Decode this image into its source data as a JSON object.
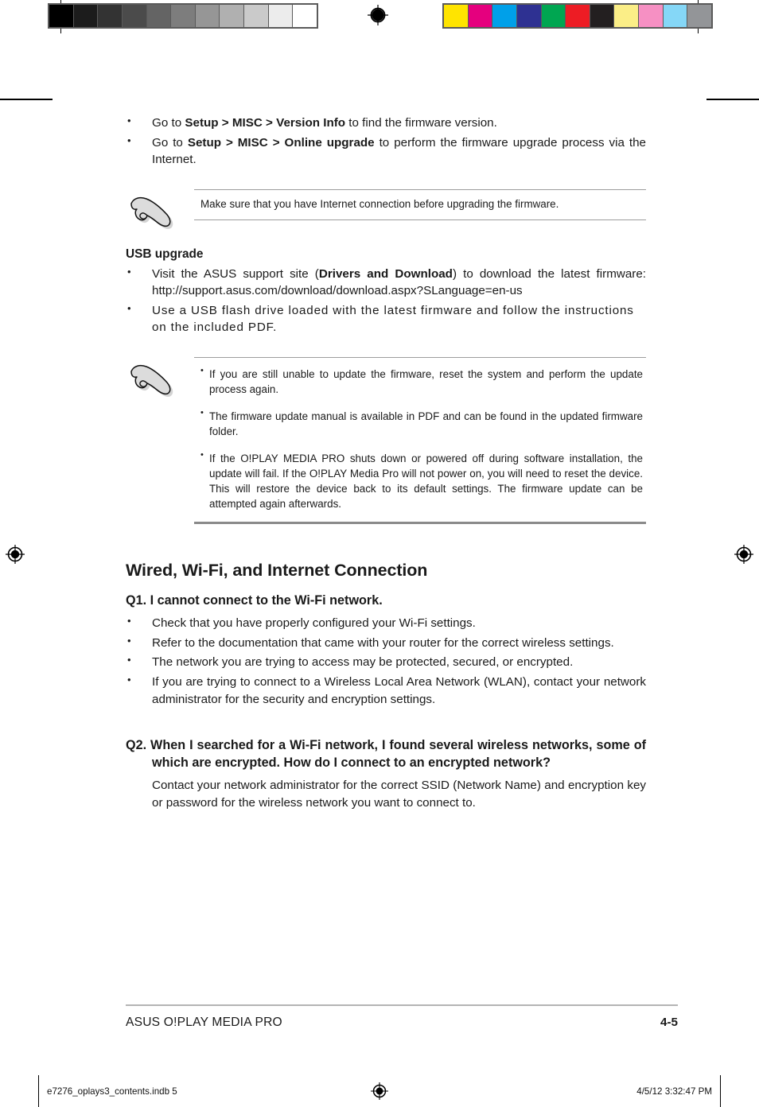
{
  "page": {
    "doc_title": "ASUS O!PLAY MEDIA PRO",
    "page_number": "4-5"
  },
  "firmware_bullets": [
    {
      "pre": "Go to ",
      "bold": "Setup > MISC > Version Info",
      "post": " to find the firmware version."
    },
    {
      "pre": "Go to ",
      "bold": "Setup > MISC > Online upgrade",
      "post": " to perform the firmware upgrade process via the Internet."
    }
  ],
  "note1": {
    "icon": "pointing-hand-icon",
    "text": "Make sure that you have Internet connection before upgrading the firmware."
  },
  "usb_upgrade": {
    "heading": "USB upgrade",
    "bullets": [
      {
        "pre": "Visit the ASUS support site (",
        "bold": "Drivers and Download",
        "post": ") to download the latest firmware: http://support.asus.com/download/download.aspx?SLanguage=en-us"
      },
      {
        "pre": "",
        "bold": "",
        "post": "Use a USB flash drive loaded with the latest firmware and follow the instructions on the included PDF."
      }
    ]
  },
  "note2": {
    "icon": "pointing-hand-icon",
    "bullets": [
      "If you are still unable to update the firmware, reset the system and perform the update process again.",
      "The firmware update manual is available in PDF and can be found in the updated firmware folder.",
      "If the O!PLAY MEDIA PRO shuts down or powered off during software installation, the update will fail. If the O!PLAY Media Pro will not power on, you will need to reset the device. This will restore the device back to its default settings.  The firmware update can be attempted again afterwards."
    ]
  },
  "connection_section": {
    "heading": "Wired, Wi-Fi, and Internet Connection",
    "q1": {
      "heading": "Q1. I cannot connect to the Wi-Fi network.",
      "bullets": [
        "Check that you have properly configured your Wi-Fi settings.",
        "Refer to the documentation that came with your router for the correct wireless settings.",
        "The network you are trying to access may be protected, secured, or encrypted.",
        "If you are trying to connect to a Wireless Local Area Network (WLAN), contact your network administrator for the security and encryption settings."
      ]
    },
    "q2": {
      "heading": "Q2. When I searched for a Wi-Fi network, I found several wireless networks, some of which are encrypted. How do I connect to an encrypted network?",
      "answer": "Contact your network administrator for the correct SSID (Network Name) and encryption key or password for the wireless network you want to connect to."
    }
  },
  "print_slug": {
    "file_name": "e7276_oplays3_contents.indb   5",
    "timestamp": "4/5/12   3:32:47 PM"
  },
  "calibration": {
    "grayscale": [
      "#000000",
      "#1c1c1c",
      "#333333",
      "#4b4b4b",
      "#646464",
      "#7d7d7d",
      "#969696",
      "#b0b0b0",
      "#cacaca",
      "#ececec",
      "#ffffff"
    ],
    "color": [
      "#ffe400",
      "#e5007e",
      "#00a0e9",
      "#2e3192",
      "#00a651",
      "#ed1c24",
      "#231f20",
      "#fbee87",
      "#f690c3",
      "#85d7f7",
      "#939598"
    ]
  }
}
